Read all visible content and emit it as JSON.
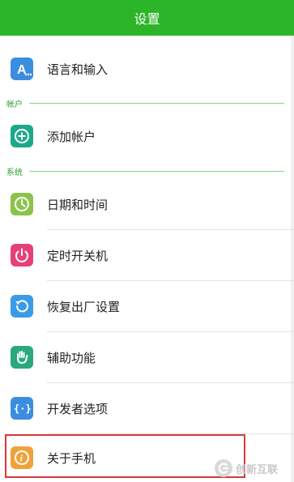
{
  "header": {
    "title": "设置"
  },
  "sections": {
    "account": "帐户",
    "system": "系统"
  },
  "items": {
    "language": {
      "label": "语言和输入",
      "icon": "language-icon",
      "color": "#3b8de0"
    },
    "add_account": {
      "label": "添加帐户",
      "icon": "add-circle-icon",
      "color": "#1ca98a"
    },
    "datetime": {
      "label": "日期和时间",
      "icon": "clock-icon",
      "color": "#8bc34a"
    },
    "power_schedule": {
      "label": "定时开关机",
      "icon": "power-icon",
      "color": "#e6407a"
    },
    "backup_reset": {
      "label": "恢复出厂设置",
      "icon": "restore-icon",
      "color": "#3a9be6"
    },
    "accessibility": {
      "label": "辅助功能",
      "icon": "hand-icon",
      "color": "#2aa87e"
    },
    "developer": {
      "label": "开发者选项",
      "icon": "code-braces-icon",
      "color": "#3b8de0"
    },
    "about": {
      "label": "关于手机",
      "icon": "info-icon",
      "color": "#f0a23a"
    }
  },
  "watermark": {
    "text": "创新互联",
    "icon": "brand-logo-icon"
  }
}
